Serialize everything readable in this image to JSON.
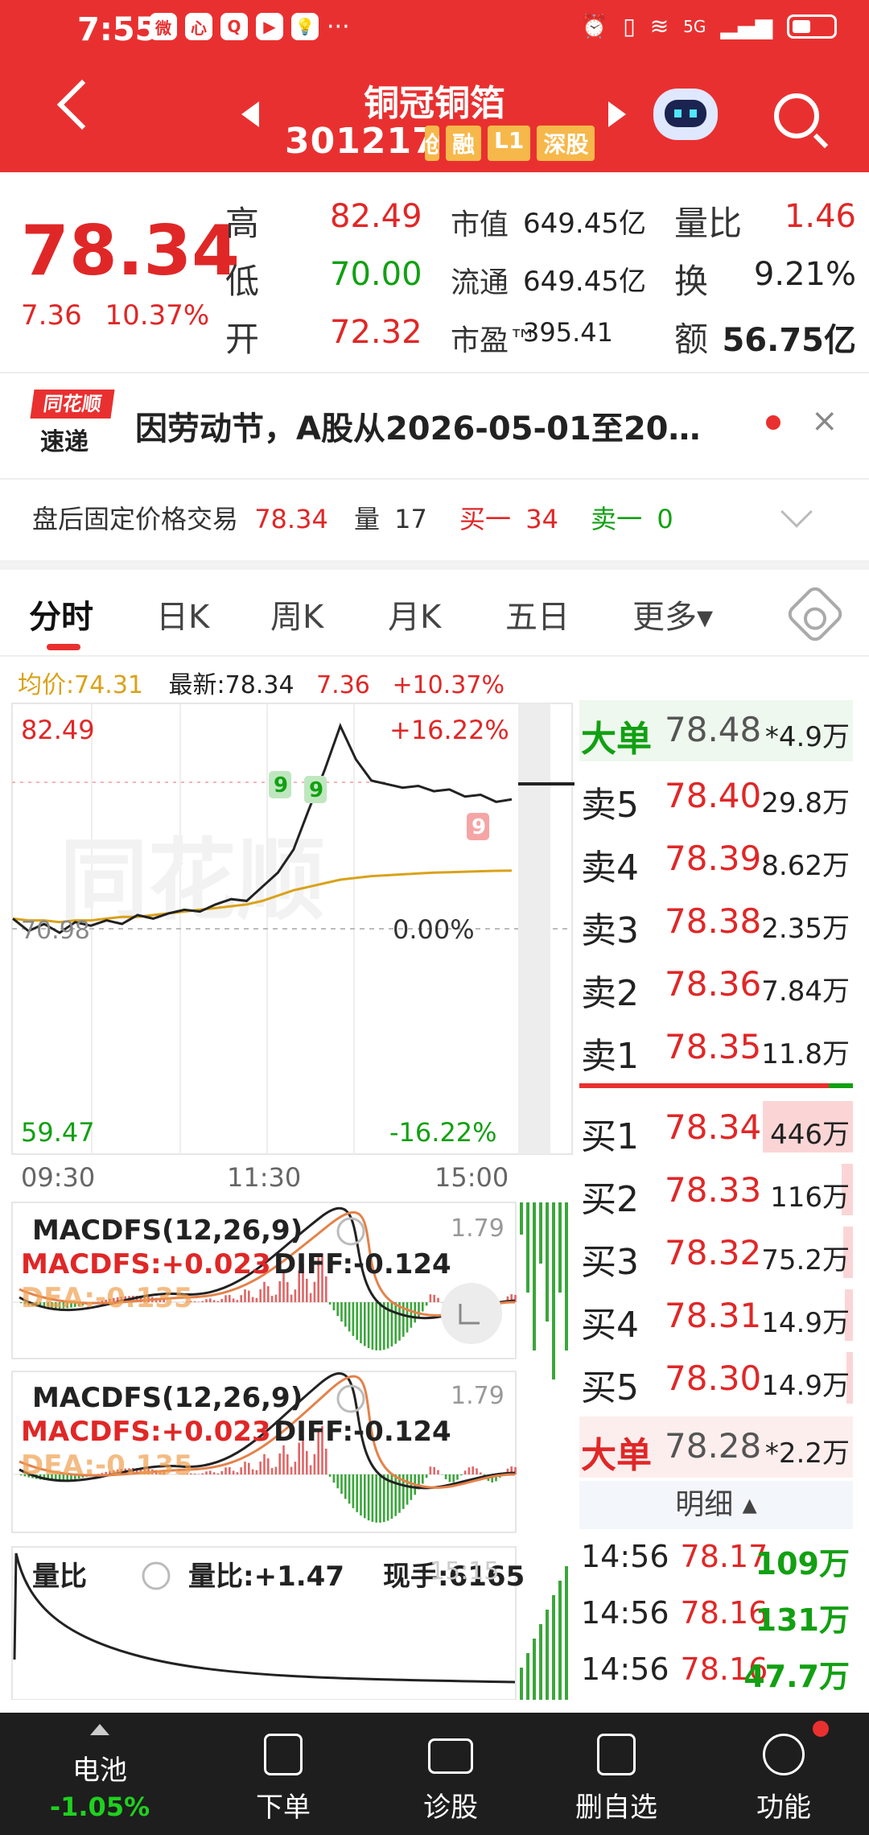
{
  "status": {
    "time": "7:55",
    "apps": [
      "微",
      "心",
      "Q",
      "▶",
      "💡"
    ],
    "more": "···",
    "net": "5G"
  },
  "header": {
    "title": "铜冠铜箔",
    "code": "301217",
    "tags": [
      "创",
      "融",
      "L1",
      "深股"
    ]
  },
  "quote": {
    "price": "78.34",
    "change": "7.36",
    "change_pct": "10.37%",
    "labels": [
      "高",
      "低",
      "开"
    ],
    "values": [
      "82.49",
      "70.00",
      "72.32"
    ],
    "mid_labels": [
      "市值",
      "流通",
      "市盈™"
    ],
    "mid_values": [
      "649.45亿",
      "649.45亿",
      "395.41"
    ],
    "right_labels": [
      "量比",
      "换",
      "额"
    ],
    "right_values": [
      "1.46",
      "9.21%",
      "56.75亿"
    ]
  },
  "news": {
    "logo_top": "同花顺",
    "logo_bottom": "速递",
    "text": "因劳动节，A股从2026-05-01至20…",
    "close": "×"
  },
  "after_hours": {
    "label": "盘后固定价格交易",
    "price": "78.34",
    "vol_label": "量",
    "vol": "17",
    "buy_label": "买一",
    "buy": "34",
    "sell_label": "卖一",
    "sell": "0"
  },
  "tabs": [
    "分时",
    "日K",
    "周K",
    "月K",
    "五日",
    "更多▾"
  ],
  "info": {
    "avg_label": "均价:74.31",
    "latest_label": "最新:78.34",
    "chg": "7.36",
    "chg_pct": "+10.37%"
  },
  "chart_data": {
    "type": "line",
    "y_top": "82.49",
    "y_mid": "70.98",
    "y_bottom": "59.47",
    "pct_top": "+16.22%",
    "pct_mid": "0.00%",
    "pct_bottom": "-16.22%",
    "times": [
      "09:30",
      "11:30",
      "15:00"
    ],
    "ylim": [
      59.47,
      82.49
    ],
    "series": [
      {
        "name": "price",
        "values": [
          71.6,
          70.9,
          71.3,
          70.8,
          71.4,
          71.2,
          71.5,
          71.3,
          71.8,
          71.6,
          71.9,
          72.1,
          72.0,
          72.4,
          72.7,
          72.6,
          73.4,
          74.2,
          75.5,
          77.8,
          80.0,
          82.49,
          80.6,
          79.4,
          79.2,
          79.0,
          79.1,
          78.8,
          78.9,
          78.5,
          78.6,
          78.2,
          78.34
        ]
      },
      {
        "name": "avg",
        "values": [
          71.6,
          71.5,
          71.5,
          71.4,
          71.5,
          71.5,
          71.6,
          71.7,
          71.7,
          71.8,
          71.9,
          72.0,
          72.1,
          72.2,
          72.3,
          72.4,
          72.6,
          72.9,
          73.2,
          73.4,
          73.6,
          73.8,
          73.9,
          74.0,
          74.05,
          74.1,
          74.15,
          74.2,
          74.22,
          74.25,
          74.28,
          74.3,
          74.31
        ]
      }
    ],
    "marks": [
      "9",
      "9",
      "9"
    ]
  },
  "macd1": {
    "title": "MACDFS(12,26,9)",
    "macd": "MACDFS:+0.023",
    "diff": "DIFF:-0.124",
    "dea": "DEA:-0.135",
    "top": "1.79"
  },
  "macd2": {
    "title": "MACDFS(12,26,9)",
    "macd": "MACDFS:+0.023",
    "diff": "DIFF:-0.124",
    "dea": "DEA:-0.135",
    "top": "1.79"
  },
  "vol_ratio": {
    "title": "量比",
    "value": "量比:+1.47",
    "hand": "现手:6165",
    "time": "15:15"
  },
  "orderbook": {
    "big_top": {
      "label": "大单",
      "price": "78.48",
      "vol": "*4.9万"
    },
    "asks": [
      {
        "label": "卖5",
        "price": "78.40",
        "vol": "29.8万"
      },
      {
        "label": "卖4",
        "price": "78.39",
        "vol": "8.62万"
      },
      {
        "label": "卖3",
        "price": "78.38",
        "vol": "2.35万"
      },
      {
        "label": "卖2",
        "price": "78.36",
        "vol": "7.84万"
      },
      {
        "label": "卖1",
        "price": "78.35",
        "vol": "11.8万"
      }
    ],
    "bids": [
      {
        "label": "买1",
        "price": "78.34",
        "vol": "446万"
      },
      {
        "label": "买2",
        "price": "78.33",
        "vol": "116万"
      },
      {
        "label": "买3",
        "price": "78.32",
        "vol": "75.2万"
      },
      {
        "label": "买4",
        "price": "78.31",
        "vol": "14.9万"
      },
      {
        "label": "买5",
        "price": "78.30",
        "vol": "14.9万"
      }
    ],
    "big_bottom": {
      "label": "大单",
      "price": "78.28",
      "vol": "*2.2万"
    },
    "detail_label": "明细 ▴",
    "ticks": [
      {
        "time": "14:56",
        "price": "78.17",
        "vol": "109万"
      },
      {
        "time": "14:56",
        "price": "78.16",
        "vol": "131万"
      },
      {
        "time": "14:56",
        "price": "78.16",
        "vol": "47.7万"
      }
    ]
  },
  "bottom_nav": [
    {
      "label": "电池",
      "sub": "-1.05%"
    },
    {
      "label": "下单"
    },
    {
      "label": "诊股"
    },
    {
      "label": "删自选"
    },
    {
      "label": "功能"
    }
  ],
  "colors": {
    "brand": "#e93030",
    "up": "#e02727",
    "down": "#12a012",
    "avg": "#d9a21a"
  }
}
